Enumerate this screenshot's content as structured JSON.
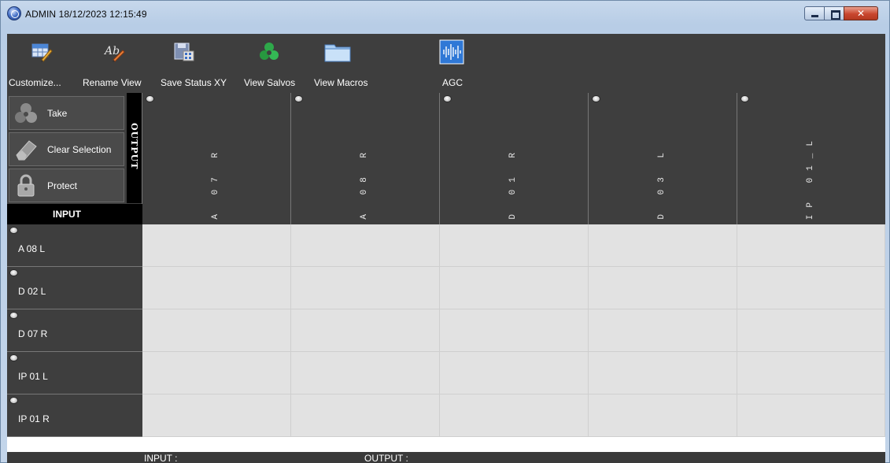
{
  "window": {
    "title": "ADMIN 18/12/2023 12:15:49"
  },
  "toolbar": {
    "items": [
      {
        "label": "Customize...",
        "icon": "customize-grid-icon"
      },
      {
        "label": "Rename View",
        "icon": "rename-ab-icon"
      },
      {
        "label": "Save Status XY",
        "icon": "floppy-save-icon"
      },
      {
        "label": "View Salvos",
        "icon": "salvos-recycle-icon"
      },
      {
        "label": "View Macros",
        "icon": "folder-macros-icon"
      },
      {
        "label": "AGC",
        "icon": "waveform-agc-icon"
      }
    ]
  },
  "commands": {
    "take": "Take",
    "clear_selection": "Clear Selection",
    "protect": "Protect",
    "output_label": "OUTPUT",
    "input_label": "INPUT"
  },
  "outputs": [
    "A 07 R",
    "A 08 R",
    "D 01 R",
    "D 03 L",
    "IP 01_L"
  ],
  "inputs": [
    "A 08 L",
    "D 02 L",
    "D 07 R",
    "IP 01 L",
    "IP 01 R"
  ],
  "status": {
    "input_label": "INPUT :",
    "output_label": "OUTPUT :"
  },
  "colors": {
    "panel": "#3e3e3e",
    "cell": "#e2e2e2",
    "strip": "#000000",
    "close_button": "#c9462e"
  }
}
